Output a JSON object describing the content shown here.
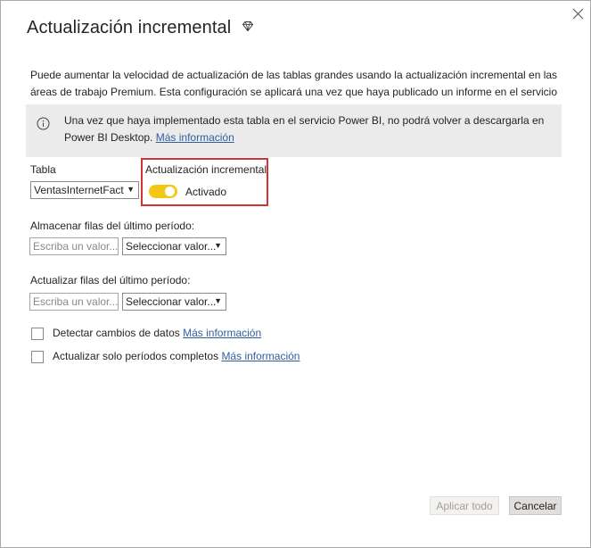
{
  "dialog": {
    "title": "Actualización incremental",
    "title_icon": "premium-diamond-icon",
    "close_icon": "close-icon",
    "intro": "Puede aumentar la velocidad de actualización de las tablas grandes usando la actualización incremental en las áreas de trabajo Premium. Esta configuración se aplicará una vez que haya publicado un informe en el servicio Power BI.",
    "info": {
      "icon": "info-icon",
      "text": "Una vez que haya implementado esta tabla en el servicio Power BI, no podrá volver a descargarla en Power BI Desktop. ",
      "link": "Más información"
    },
    "table": {
      "label": "Tabla",
      "selected": "VentasInternetFact"
    },
    "incremental": {
      "label": "Actualización incremental",
      "toggle_state": "Activado",
      "enabled": true,
      "toggle_color": "#f2c811",
      "highlight_color": "#d13438"
    },
    "store": {
      "label": "Almacenar filas del último período:",
      "value_placeholder": "Escriba un valor...",
      "period_selected": "Seleccionar valor..."
    },
    "refresh": {
      "label": "Actualizar filas del último período:",
      "value_placeholder": "Escriba un valor...",
      "period_selected": "Seleccionar valor..."
    },
    "detect_changes": {
      "label": "Detectar cambios de datos",
      "link": "Más información",
      "checked": false
    },
    "complete_periods": {
      "label": "Actualizar solo períodos completos",
      "link": "Más información",
      "checked": false
    },
    "buttons": {
      "apply_all": "Aplicar todo",
      "cancel": "Cancelar"
    }
  }
}
